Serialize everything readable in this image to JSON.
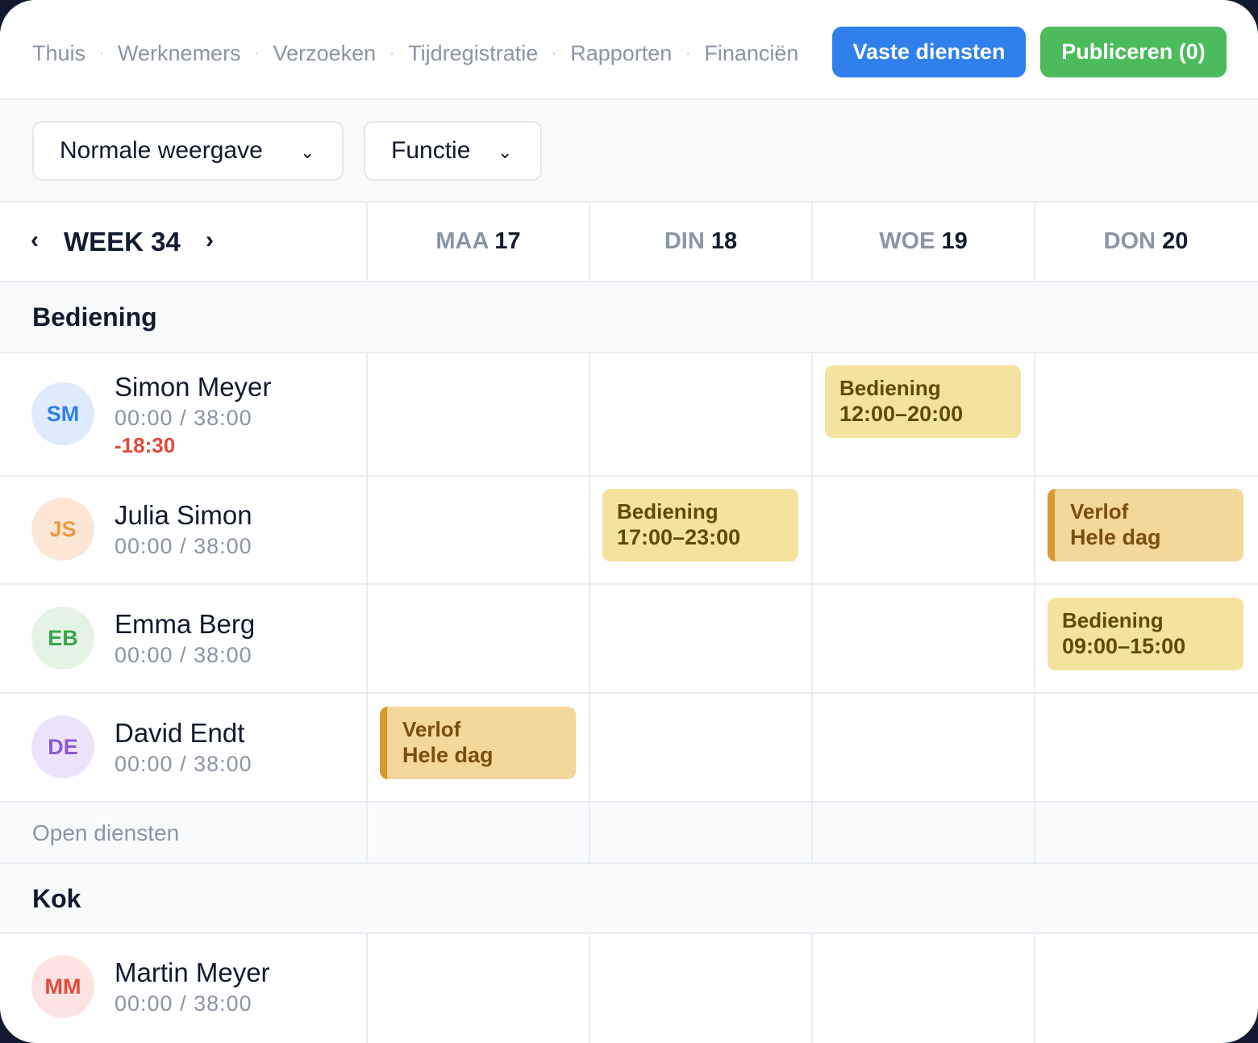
{
  "nav": {
    "items": [
      "Thuis",
      "Werknemers",
      "Verzoeken",
      "Tijdregistratie",
      "Rapporten",
      "Financiën"
    ],
    "separator": "·"
  },
  "actions": {
    "fixed_shifts": "Vaste diensten",
    "publish": "Publiceren (0)"
  },
  "filters": {
    "view": "Normale weergave",
    "function": "Functie",
    "chevron": "⌄"
  },
  "week": {
    "label": "WEEK 34",
    "prev": "‹",
    "next": "›"
  },
  "days": [
    {
      "name": "MAA",
      "num": "17"
    },
    {
      "name": "DIN",
      "num": "18"
    },
    {
      "name": "WOE",
      "num": "19"
    },
    {
      "name": "DON",
      "num": "20"
    }
  ],
  "sections": [
    {
      "title": "Bediening",
      "employees": [
        {
          "initials": "SM",
          "name": "Simon Meyer",
          "hours": "00:00 / 38:00",
          "balance": "-18:30"
        },
        {
          "initials": "JS",
          "name": "Julia Simon",
          "hours": "00:00 / 38:00"
        },
        {
          "initials": "EB",
          "name": "Emma Berg",
          "hours": "00:00 / 38:00"
        },
        {
          "initials": "DE",
          "name": "David Endt",
          "hours": "00:00 / 38:00"
        }
      ],
      "open_label": "Open diensten"
    },
    {
      "title": "Kok",
      "employees": [
        {
          "initials": "MM",
          "name": "Martin Meyer",
          "hours": "00:00 / 38:00"
        }
      ]
    }
  ],
  "shifts": [
    {
      "employee": "Simon Meyer",
      "day": "WOE 19",
      "type": "work",
      "title": "Bediening",
      "detail": "12:00–20:00"
    },
    {
      "employee": "Julia Simon",
      "day": "DIN 18",
      "type": "work",
      "title": "Bediening",
      "detail": "17:00–23:00"
    },
    {
      "employee": "Julia Simon",
      "day": "DON 20",
      "type": "leave",
      "title": "Verlof",
      "detail": "Hele dag"
    },
    {
      "employee": "Emma Berg",
      "day": "DON 20",
      "type": "work",
      "title": "Bediening",
      "detail": "09:00–15:00"
    },
    {
      "employee": "David Endt",
      "day": "MAA 17",
      "type": "leave",
      "title": "Verlof",
      "detail": "Hele dag"
    }
  ],
  "colors": {
    "primary": "#2f80ed",
    "success": "#4cbb5b",
    "negative": "#e04a3a",
    "shift_work": "#f4e39e",
    "shift_leave": "#f4d79b"
  }
}
